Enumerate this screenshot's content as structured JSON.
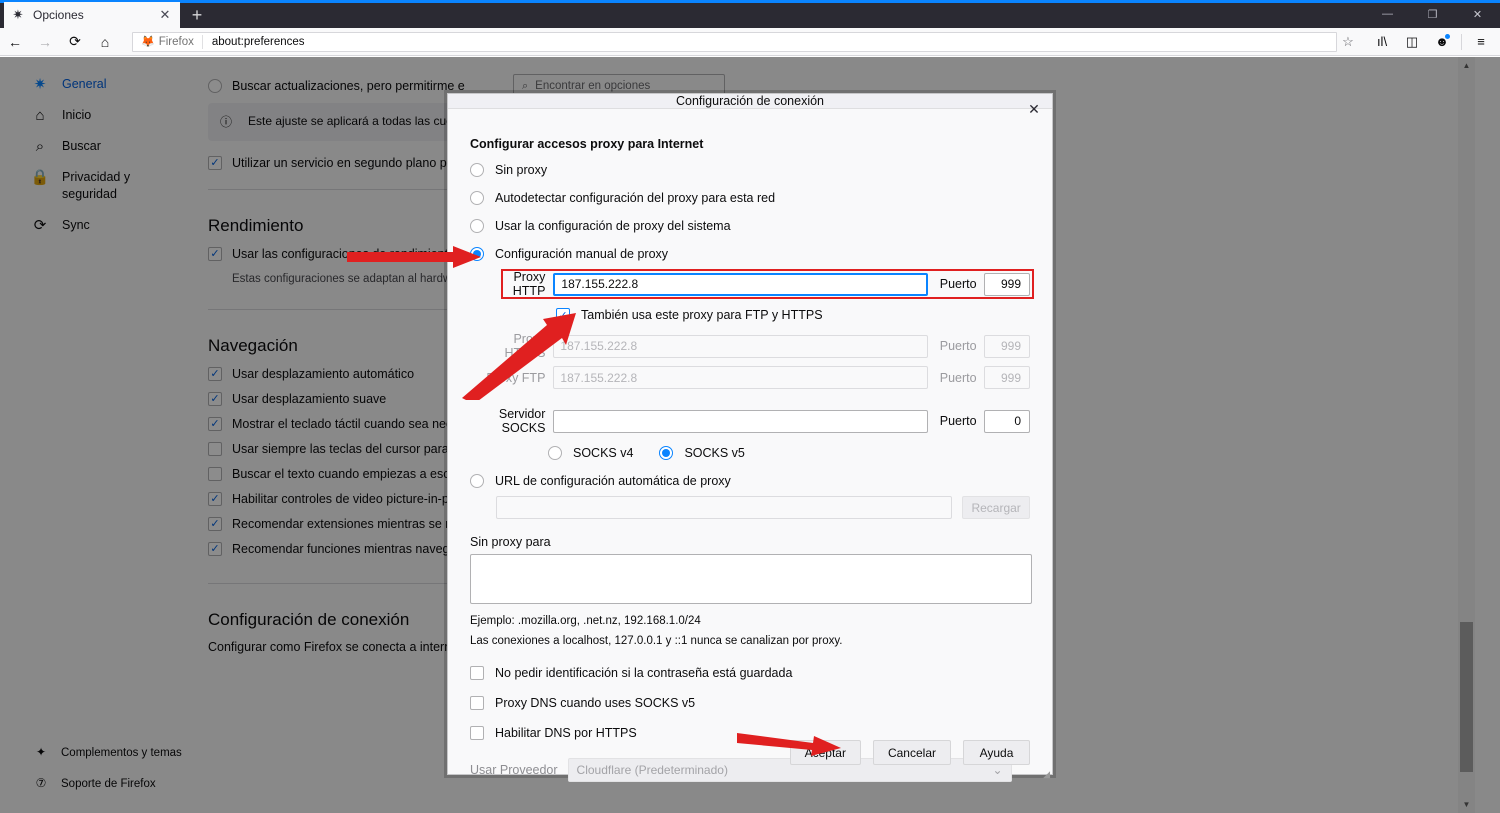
{
  "window": {
    "tab_title": "Opciones",
    "tab_favicon_icon": "gear-icon",
    "new_tab_label": "+",
    "minimize_label": "—",
    "maximize_label": "❐",
    "close_label": "✕"
  },
  "navbar": {
    "back_icon": "←",
    "forward_icon": "→",
    "reload_icon": "⟳",
    "home_icon": "⌂",
    "identity_label": "Firefox",
    "identity_icon": "firefox-icon",
    "url": "about:preferences",
    "bookmark_icon": "☆",
    "library_icon": "library-icon",
    "sidebar_icon": "sidebar-icon",
    "account_icon": "account-icon",
    "menu_icon": "≡"
  },
  "search": {
    "placeholder": "Encontrar en opciones",
    "icon": "search-icon"
  },
  "sidebar": {
    "items": [
      {
        "label": "General",
        "icon": "gear-icon",
        "glyph": "✷",
        "active": true
      },
      {
        "label": "Inicio",
        "icon": "home-icon",
        "glyph": "⌂",
        "active": false
      },
      {
        "label": "Buscar",
        "icon": "search-icon",
        "glyph": "⌕",
        "active": false
      },
      {
        "label": "Privacidad y seguridad",
        "icon": "lock-icon",
        "glyph": "🔒",
        "active": false
      },
      {
        "label": "Sync",
        "icon": "sync-icon",
        "glyph": "⟳",
        "active": false
      }
    ],
    "footer": [
      {
        "label": "Complementos y temas",
        "icon": "puzzle-icon",
        "glyph": "✦"
      },
      {
        "label": "Soporte de Firefox",
        "icon": "help-icon",
        "glyph": "?"
      }
    ]
  },
  "page": {
    "update_option_label": "Buscar actualizaciones, pero permitirme e",
    "info_note": "Este ajuste se aplicará a todas las cuenta instalación de Firefox.",
    "info_icon": "info-icon",
    "background_service_label": "Utilizar un servicio en segundo plano para",
    "performance": {
      "heading": "Rendimiento",
      "recommended_label": "Usar las configuraciones de rendimiento r",
      "note": "Estas configuraciones se adaptan al hardware"
    },
    "browsing": {
      "heading": "Navegación",
      "items": [
        {
          "label": "Usar desplazamiento automático",
          "checked": true
        },
        {
          "label": "Usar desplazamiento suave",
          "checked": true
        },
        {
          "label": "Mostrar el teclado táctil cuando sea neces",
          "checked": true
        },
        {
          "label": "Usar siempre las teclas del cursor para nav",
          "checked": false
        },
        {
          "label": "Buscar el texto cuando empiezas a escribi",
          "checked": false
        },
        {
          "label": "Habilitar controles de video picture-in-pic",
          "checked": true
        },
        {
          "label": "Recomendar extensiones mientras se nave",
          "checked": true
        },
        {
          "label": "Recomendar funciones mientras navegas",
          "checked": true
        }
      ]
    },
    "connection": {
      "heading": "Configuración de conexión",
      "description": "Configurar como Firefox se conecta a internet."
    }
  },
  "dialog": {
    "title": "Configuración de conexión",
    "close_icon": "close-icon",
    "heading": "Configurar accesos proxy para Internet",
    "proxy_modes": [
      {
        "label": "Sin proxy",
        "selected": false
      },
      {
        "label": "Autodetectar configuración del proxy para esta red",
        "selected": false
      },
      {
        "label": "Usar la configuración de proxy del sistema",
        "selected": false
      },
      {
        "label": "Configuración manual de proxy",
        "selected": true
      }
    ],
    "http_proxy": {
      "label": "Proxy HTTP",
      "value": "187.155.222.8",
      "port_label": "Puerto",
      "port_value": "999"
    },
    "share_proxy": {
      "label": "También usa este proxy para FTP y HTTPS",
      "checked": true
    },
    "https_proxy": {
      "label": "Proxy HTTPS",
      "value": "187.155.222.8",
      "port_label": "Puerto",
      "port_value": "999"
    },
    "ftp_proxy": {
      "label": "Proxy FTP",
      "value": "187.155.222.8",
      "port_label": "Puerto",
      "port_value": "999"
    },
    "socks": {
      "label": "Servidor SOCKS",
      "value": "",
      "port_label": "Puerto",
      "port_value": "0",
      "versions": [
        {
          "label": "SOCKS v4",
          "selected": false
        },
        {
          "label": "SOCKS v5",
          "selected": true
        }
      ]
    },
    "autoconfig": {
      "label": "URL de configuración automática de proxy",
      "selected": false,
      "url_value": "",
      "reload_label": "Recargar"
    },
    "no_proxy": {
      "label": "Sin proxy para",
      "value": "",
      "example": "Ejemplo: .mozilla.org, .net.nz, 192.168.1.0/24",
      "localhost_note": "Las conexiones a localhost, 127.0.0.1 y ::1 nunca se canalizan por proxy."
    },
    "checkboxes": [
      {
        "label": "No pedir identificación si la contraseña está guardada",
        "checked": false
      },
      {
        "label": "Proxy DNS cuando uses SOCKS v5",
        "checked": false
      },
      {
        "label": "Habilitar DNS por HTTPS",
        "checked": false
      }
    ],
    "provider": {
      "label": "Usar Proveedor",
      "value": "Cloudflare (Predeterminado)",
      "chevron_icon": "chevron-down-icon"
    },
    "buttons": {
      "accept": "Aceptar",
      "cancel": "Cancelar",
      "help": "Ayuda"
    },
    "resize_grip_icon": "resize-grip-icon"
  },
  "annotations": {
    "highlight_color": "#e02020",
    "arrow_color": "#e02020",
    "arrows": [
      {
        "name": "arrow-to-manual-proxy-radio"
      },
      {
        "name": "arrow-to-share-proxy-checkbox"
      },
      {
        "name": "arrow-to-accept-button"
      }
    ]
  },
  "colors": {
    "accent": "#0a84ff",
    "titlebar": "#2b2a33",
    "page_bg": "#f9f9fa",
    "dialog_bg": "#f9f9fa",
    "red": "#e02020"
  }
}
